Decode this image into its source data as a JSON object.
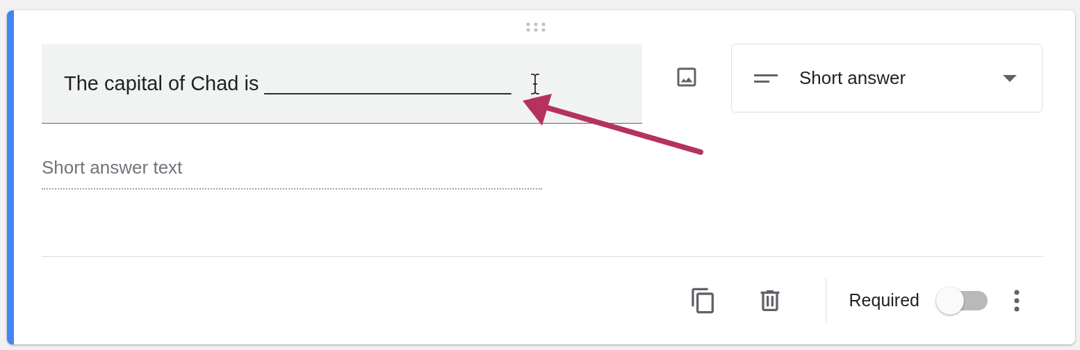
{
  "question": {
    "title": "The capital of Chad is ______________________",
    "type_dropdown": {
      "label": "Short answer"
    },
    "answer_placeholder": "Short answer text"
  },
  "footer": {
    "required": {
      "label": "Required",
      "on": false
    }
  }
}
